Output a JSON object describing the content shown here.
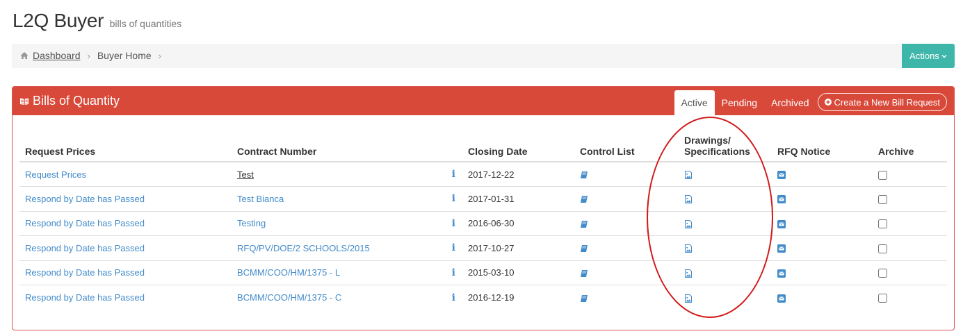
{
  "header": {
    "title": "L2Q Buyer",
    "subtitle": "bills of quantities"
  },
  "breadcrumb": {
    "home_icon": "home-icon",
    "dashboard": "Dashboard",
    "current": "Buyer Home",
    "separator": "›"
  },
  "actions": {
    "label": "Actions"
  },
  "panel": {
    "title": "Bills of Quantity",
    "tabs": [
      {
        "label": "Active"
      },
      {
        "label": "Pending"
      },
      {
        "label": "Archived"
      }
    ],
    "create_label": "Create a New Bill Request"
  },
  "table": {
    "headers": {
      "request_prices": "Request Prices",
      "contract_number": "Contract Number",
      "closing_date": "Closing Date",
      "control_list": "Control List",
      "drawings_line1": "Drawings/",
      "drawings_line2": "Specifications",
      "rfq_notice": "RFQ Notice",
      "archive": "Archive"
    },
    "info_glyph": "i",
    "rows": [
      {
        "request": "Request Prices",
        "contract": "Test",
        "date": "2017-12-22"
      },
      {
        "request": "Respond by Date has Passed",
        "contract": "Test Bianca",
        "date": "2017-01-31"
      },
      {
        "request": "Respond by Date has Passed",
        "contract": "Testing",
        "date": "2016-06-30"
      },
      {
        "request": "Respond by Date has Passed",
        "contract": "RFQ/PV/DOE/2 SCHOOLS/2015",
        "date": "2017-10-27"
      },
      {
        "request": "Respond by Date has Passed",
        "contract": "BCMM/COO/HM/1375 - L",
        "date": "2015-03-10"
      },
      {
        "request": "Respond by Date has Passed",
        "contract": "BCMM/COO/HM/1375 - C",
        "date": "2016-12-19"
      }
    ]
  },
  "colors": {
    "panel_red": "#d9493a",
    "actions_teal": "#3fb6aa",
    "link_blue": "#428bca",
    "annotation_red": "#d11a1a"
  }
}
